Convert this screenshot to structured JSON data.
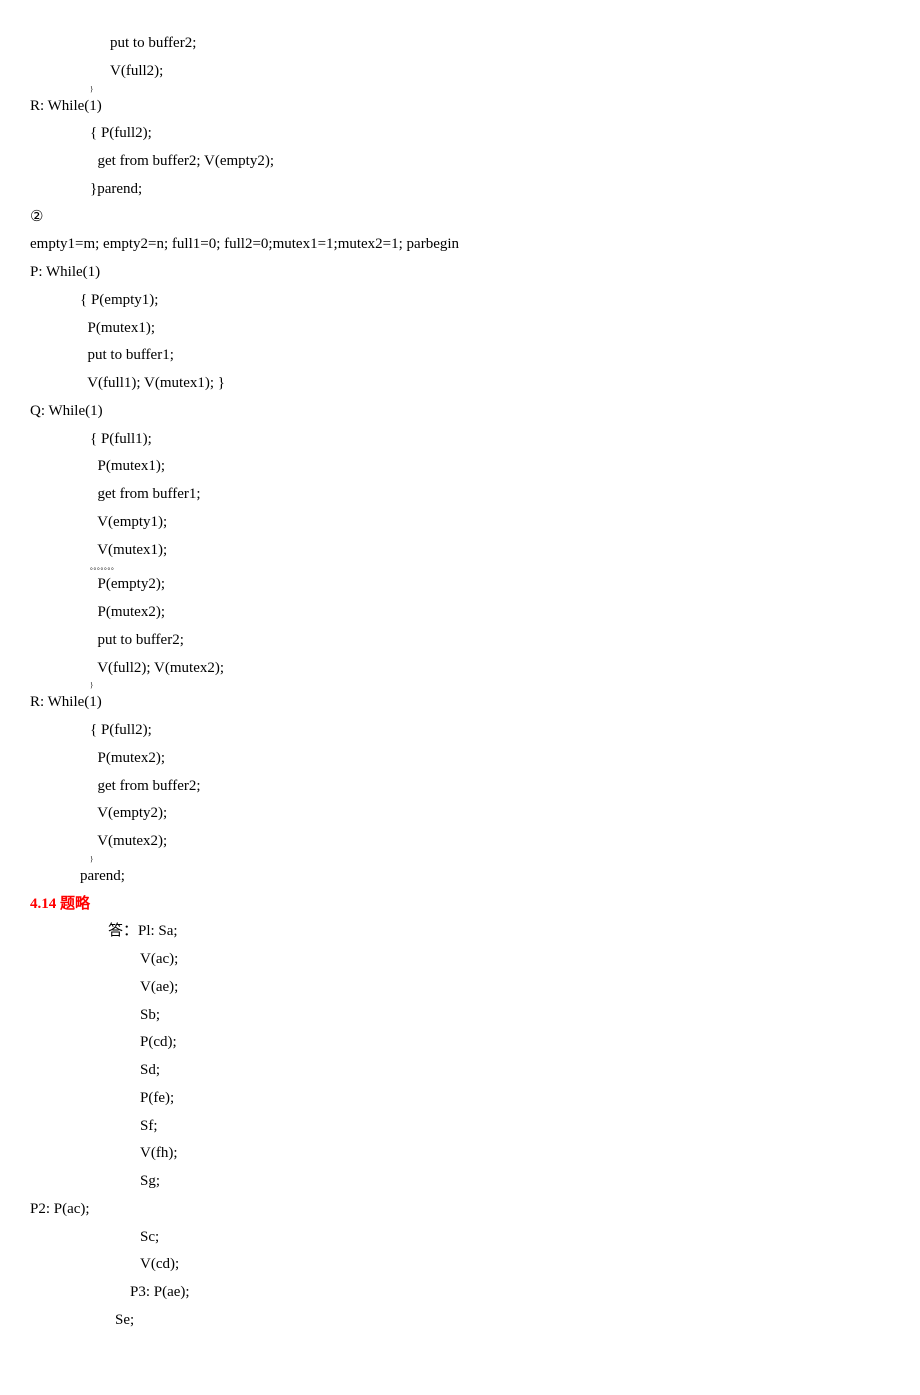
{
  "lines": [
    {
      "cls": "ind1",
      "text": "put to buffer2;"
    },
    {
      "cls": "ind1",
      "text": "V(full2);"
    },
    {
      "cls": "tiny",
      "text": "}"
    },
    {
      "cls": "ind0",
      "text": "R: While(1)"
    },
    {
      "cls": "ind2",
      "text": "{ P(full2);"
    },
    {
      "cls": "ind2",
      "text": "  get from buffer2; V(empty2);"
    },
    {
      "cls": "ind2",
      "text": "}parend;"
    },
    {
      "cls": "ind0",
      "text": "②"
    },
    {
      "cls": "ind0",
      "text": "empty1=m; empty2=n; full1=0; full2=0;mutex1=1;mutex2=1; parbegin"
    },
    {
      "cls": "ind0",
      "text": "P: While(1)"
    },
    {
      "cls": "ind3",
      "text": "{ P(empty1);"
    },
    {
      "cls": "ind3",
      "text": "  P(mutex1);"
    },
    {
      "cls": "ind3",
      "text": "  put to buffer1;"
    },
    {
      "cls": "ind3",
      "text": "  V(full1); V(mutex1); }"
    },
    {
      "cls": "ind0",
      "text": "Q: While(1)"
    },
    {
      "cls": "ind2",
      "text": "{ P(full1);"
    },
    {
      "cls": "ind2",
      "text": "  P(mutex1);"
    },
    {
      "cls": "ind2",
      "text": "  get from buffer1;"
    },
    {
      "cls": "ind2",
      "text": "  V(empty1);"
    },
    {
      "cls": "ind2",
      "text": "  V(mutex1);"
    },
    {
      "cls": "tiny",
      "text": "。。。。。。。"
    },
    {
      "cls": "ind2",
      "text": "  P(empty2);"
    },
    {
      "cls": "ind2",
      "text": "  P(mutex2);"
    },
    {
      "cls": "ind2",
      "text": "  put to buffer2;"
    },
    {
      "cls": "ind2",
      "text": "  V(full2); V(mutex2);"
    },
    {
      "cls": "tiny",
      "text": "}"
    },
    {
      "cls": "ind0",
      "text": "R: While(1)"
    },
    {
      "cls": "ind2",
      "text": "{ P(full2);"
    },
    {
      "cls": "ind2",
      "text": "  P(mutex2);"
    },
    {
      "cls": "ind2",
      "text": "  get from buffer2;"
    },
    {
      "cls": "ind2",
      "text": "  V(empty2);"
    },
    {
      "cls": "ind2",
      "text": "  V(mutex2);"
    },
    {
      "cls": "tiny",
      "text": "}"
    },
    {
      "cls": "ind3",
      "text": "parend;"
    },
    {
      "cls": "ind0 red",
      "text": "4.14 题略"
    },
    {
      "cls": "ind1a",
      "text": "答：Pl: Sa;"
    },
    {
      "cls": "indv",
      "text": "V(ac);"
    },
    {
      "cls": "indv",
      "text": "V(ae);"
    },
    {
      "cls": "indv",
      "text": "Sb;"
    },
    {
      "cls": "indv",
      "text": "P(cd);"
    },
    {
      "cls": "indv",
      "text": "Sd;"
    },
    {
      "cls": "indv",
      "text": "P(fe);"
    },
    {
      "cls": "indv",
      "text": "Sf;"
    },
    {
      "cls": "indv",
      "text": "V(fh);"
    },
    {
      "cls": "indv",
      "text": "Sg;"
    },
    {
      "cls": "ind0",
      "text": "P2: P(ac);"
    },
    {
      "cls": "indv",
      "text": "Sc;"
    },
    {
      "cls": "indv",
      "text": "V(cd);"
    },
    {
      "cls": "indp2",
      "text": "P3: P(ae);"
    },
    {
      "cls": "indse",
      "text": "Se;"
    }
  ]
}
